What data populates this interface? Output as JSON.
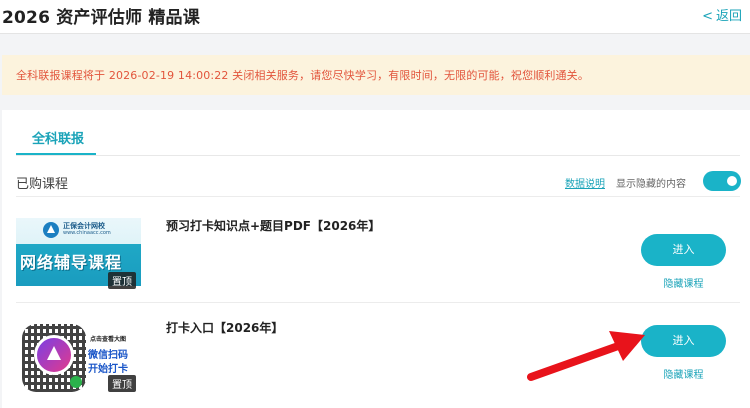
{
  "header": {
    "title": "2026 资产评估师 精品课",
    "back_label": "返回",
    "back_icon": "chevron-left-icon"
  },
  "notice": {
    "text": "全科联报课程将于 2026-02-19 14:00:22 关闭相关服务，请您尽快学习，有限时间，无限的可能，祝您顺利通关。",
    "color": "#e2553c"
  },
  "tabs": [
    {
      "label": "全科联报",
      "active": true
    }
  ],
  "purchased": {
    "label": "已购课程",
    "explain_link": "数据说明",
    "show_hidden_label": "显示隐藏的内容",
    "show_hidden_on": true
  },
  "courses": [
    {
      "title": "预习打卡知识点+题目PDF【2026年】",
      "thumb_brand": "正保会计网校",
      "thumb_url": "www.chinaacc.com",
      "thumb_title": "网络辅导课程",
      "pin_label": "置顶",
      "enter_label": "进入",
      "hide_label": "隐藏课程"
    },
    {
      "title": "打卡入口【2026年】",
      "thumb_hint": "点击查看大图",
      "thumb_line1": "微信扫码",
      "thumb_line2": "开始打卡",
      "pin_label": "置顶",
      "enter_label": "进入",
      "hide_label": "隐藏课程"
    }
  ],
  "colors": {
    "accent": "#1ab3c8",
    "annotation_arrow": "#e8131b"
  }
}
